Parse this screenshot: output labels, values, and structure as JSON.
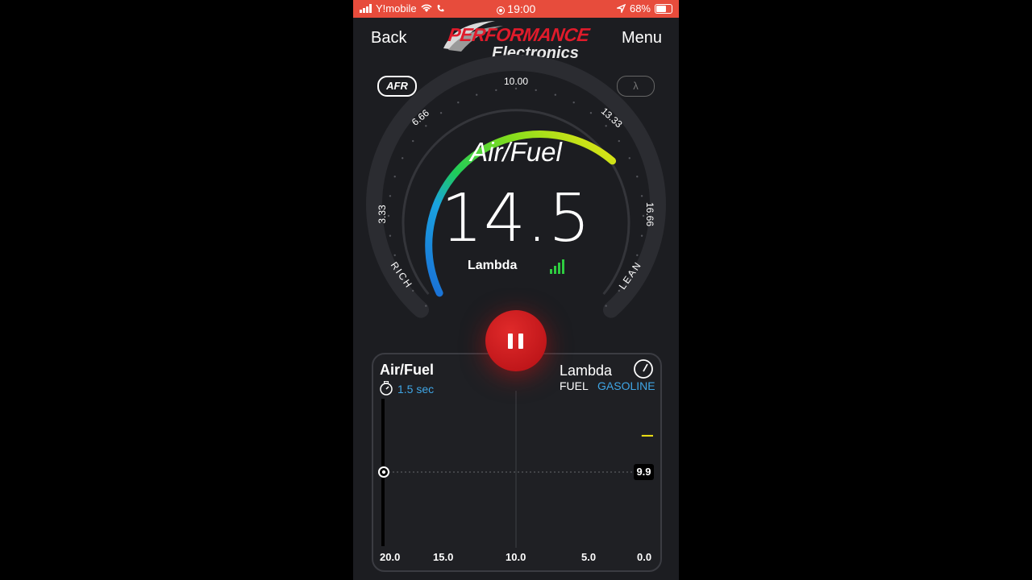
{
  "status": {
    "carrier": "Y!mobile",
    "time": "19:00",
    "battery": "68%"
  },
  "nav": {
    "back": "Back",
    "menu": "Menu"
  },
  "logo": {
    "line1": "PERFORMANCE",
    "line2": "Electronics"
  },
  "mode": {
    "afr": "AFR",
    "lambda": "λ"
  },
  "gauge": {
    "title": "Air/Fuel",
    "value": "14.5",
    "unit": "Lambda",
    "scale": [
      "3.33",
      "6.66",
      "10.00",
      "13.33",
      "16.66"
    ],
    "rich": "RICH",
    "lean": "LEAN",
    "signal_bars": 4
  },
  "chart": {
    "title": "Air/Fuel",
    "interval": "1.5 sec",
    "sensor": "Lambda",
    "fuel_label": "FUEL",
    "fuel_value": "GASOLINE",
    "marker_value": "9.9",
    "x_ticks": [
      "20.0",
      "15.0",
      "10.0",
      "5.0",
      "0.0"
    ]
  },
  "chart_data": {
    "type": "line",
    "title": "Air/Fuel",
    "x_ticks": [
      "20.0",
      "15.0",
      "10.0",
      "5.0",
      "0.0"
    ],
    "x_range": [
      20.0,
      0.0
    ],
    "series": [
      {
        "values": [
          [
            0.9,
            14.5
          ],
          [
            0.0,
            14.5
          ]
        ]
      }
    ],
    "reference_value": 9.9,
    "colors": {
      "line": "#f1e514"
    }
  },
  "colors": {
    "accent": "#e01b2b",
    "blue": "#3fa6e6",
    "yellow": "#f1e514",
    "green": "#2ecc40"
  }
}
